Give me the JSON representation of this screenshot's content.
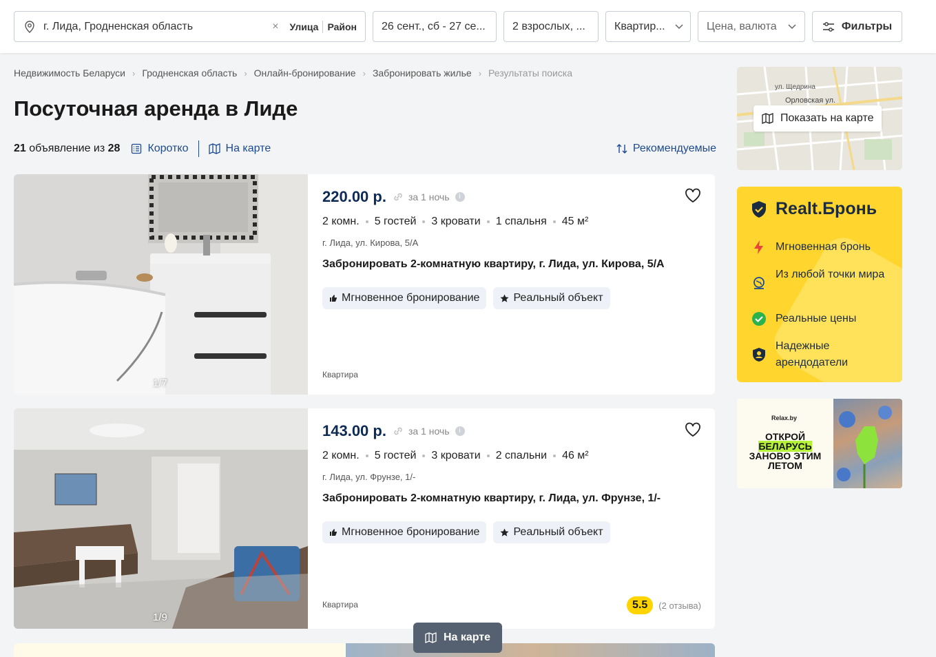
{
  "search": {
    "location": "г. Лида, Гродненская область",
    "clear": "×",
    "street_label": "Улица",
    "district_label": "Район",
    "dates": "26 сент., сб - 27 се...",
    "guests": "2 взрослых, ...",
    "type": "Квартир...",
    "price_placeholder": "Цена, валюта",
    "filters_label": "Фильтры"
  },
  "breadcrumb": [
    "Недвижимость Беларуси",
    "Гродненская область",
    "Онлайн-бронирование",
    "Забронировать жилье",
    "Результаты поиска"
  ],
  "page_title": "Посуточная аренда в Лиде",
  "results": {
    "count": "21",
    "count_text": " объявление из ",
    "total": "28",
    "short_label": "Коротко",
    "map_label": "На карте",
    "sort_label": "Рекомендуемые"
  },
  "listings": [
    {
      "price": "220.00 р.",
      "per": "за 1 ночь",
      "rooms": "2 комн.",
      "guests": "5 гостей",
      "beds": "3 кровати",
      "bedrooms": "1 спальня",
      "area": "45 м²",
      "address": "г. Лида, ул. Кирова, 5/А",
      "title": "Забронировать 2-комнатную квартиру, г. Лида, ул. Кирова, 5/А",
      "tag_instant": "Мгновенное бронирование",
      "tag_real": "Реальный объект",
      "kind": "Квартира",
      "photo_counter": "1/7"
    },
    {
      "price": "143.00 р.",
      "per": "за 1 ночь",
      "rooms": "2 комн.",
      "guests": "5 гостей",
      "beds": "3 кровати",
      "bedrooms": "2 спальни",
      "area": "46 м²",
      "address": "г. Лида, ул. Фрунзе, 1/-",
      "title": "Забронировать 2-комнатную квартиру, г. Лида, ул. Фрунзе, 1/-",
      "tag_instant": "Мгновенное бронирование",
      "tag_real": "Реальный объект",
      "kind": "Квартира",
      "photo_counter": "1/9",
      "rating": "5.5",
      "reviews": "(2 отзыва)"
    }
  ],
  "floating_map_label": "На карте",
  "map_widget": {
    "button_label": "Показать на карте",
    "street_1": "ул. Щедрина",
    "street_2": "Орловская ул."
  },
  "promo": {
    "brand": "Realt.Бронь",
    "items": [
      "Мгновенная бронь",
      "Из любой точки мира",
      "Реальные цены",
      "Надежные арендодатели"
    ]
  },
  "banner": {
    "brand": "Relax.by",
    "line1": "ОТКРОЙ",
    "line2": "БЕЛАРУСЬ",
    "line3": "ЗАНОВО ЭТИМ",
    "line4": "ЛЕТОМ"
  },
  "colors": {
    "accent": "#1d4a8f",
    "price": "#0d2a55",
    "promo_bg": "#ffd52e",
    "rating_bg": "#ffd400"
  }
}
